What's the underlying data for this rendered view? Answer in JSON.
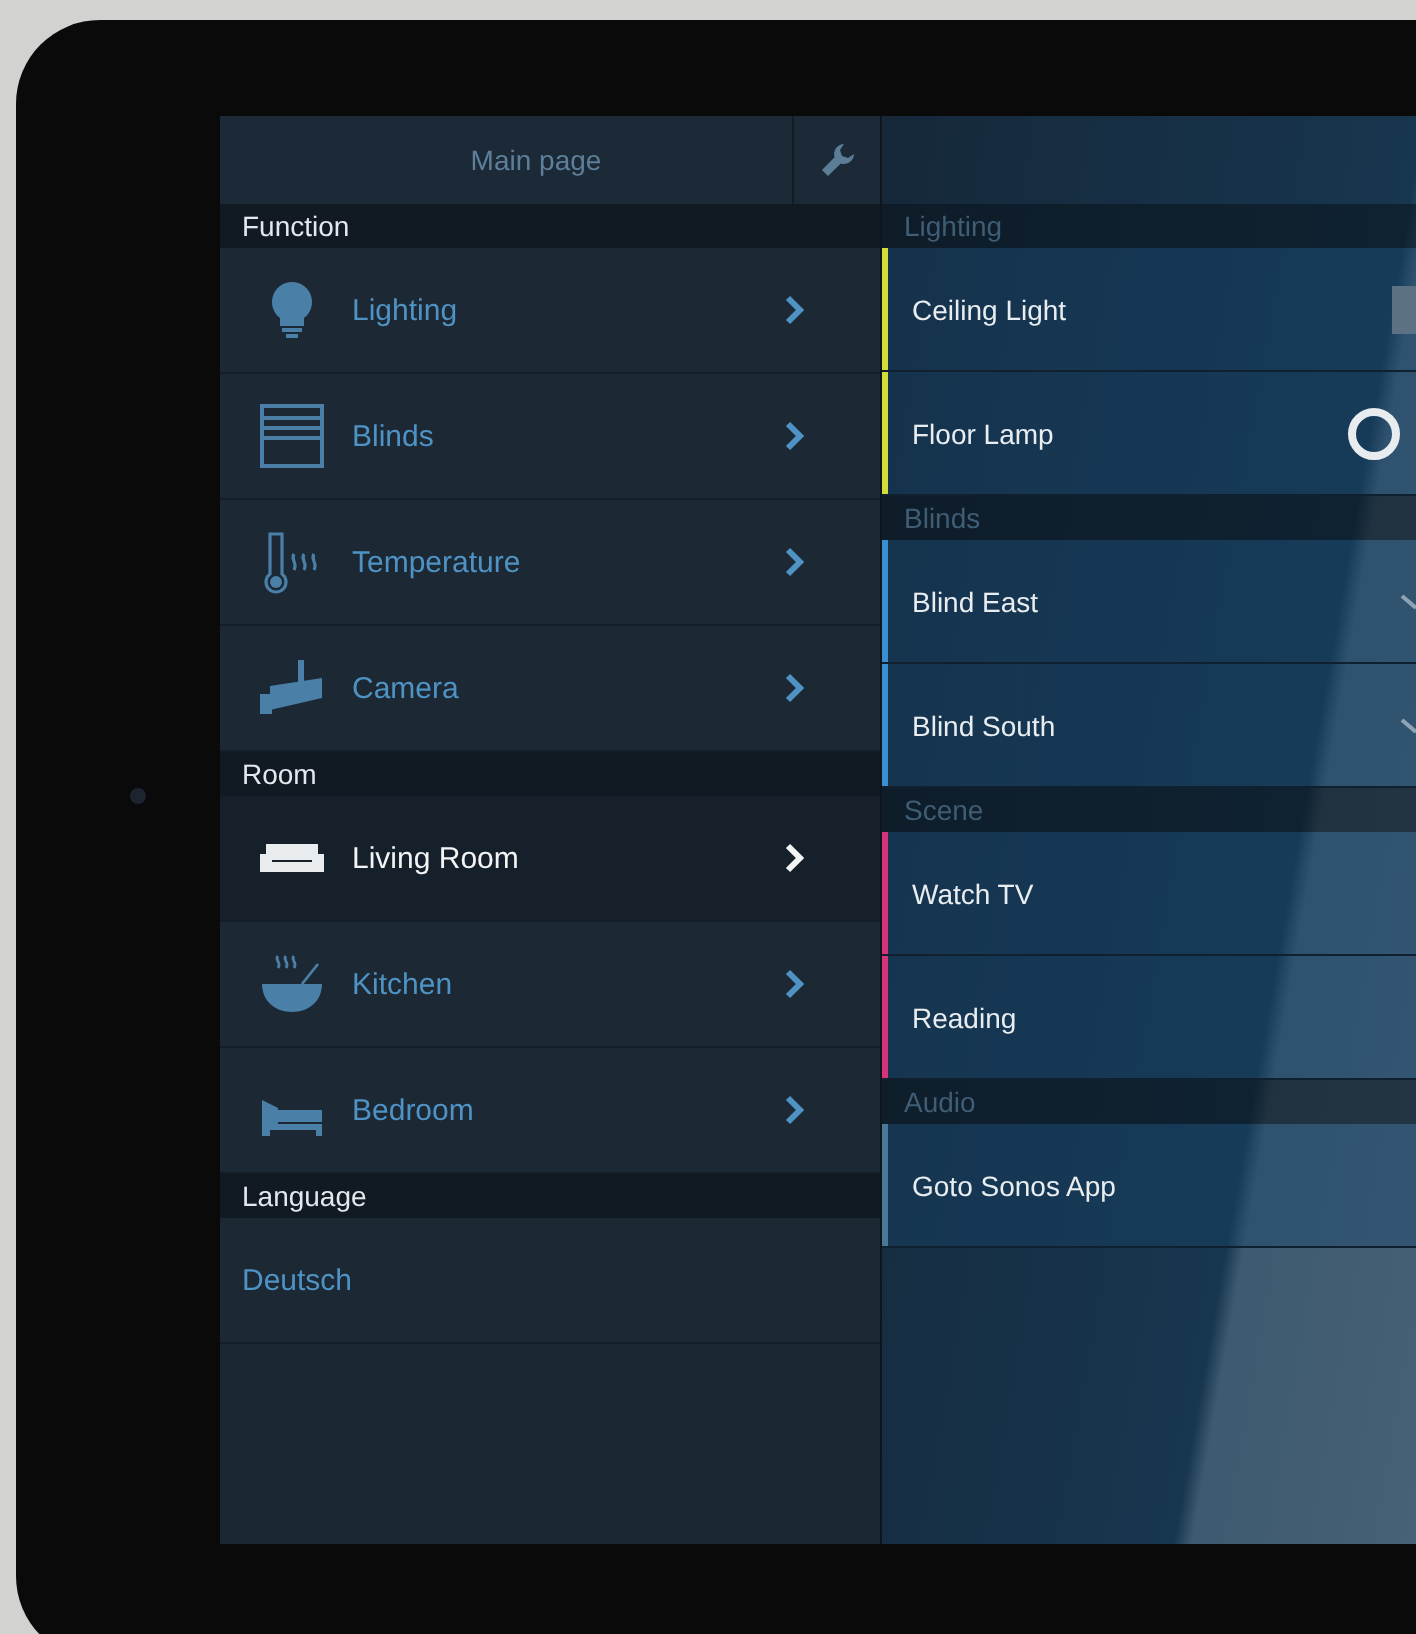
{
  "header": {
    "title": "Main page"
  },
  "menu": [
    {
      "heading": "Function",
      "items": [
        {
          "label": "Lighting",
          "selected": false
        },
        {
          "label": "Blinds",
          "selected": false
        },
        {
          "label": "Temperature",
          "selected": false
        },
        {
          "label": "Camera",
          "selected": false
        }
      ]
    },
    {
      "heading": "Room",
      "items": [
        {
          "label": "Living Room",
          "selected": true
        },
        {
          "label": "Kitchen",
          "selected": false
        },
        {
          "label": "Bedroom",
          "selected": false
        }
      ]
    },
    {
      "heading": "Language",
      "items": [
        {
          "label": "Deutsch",
          "selected": false,
          "kind": "link"
        }
      ]
    }
  ],
  "detail": [
    {
      "heading": "Lighting",
      "items": [
        {
          "label": "Ceiling Light",
          "color": "#d4dc3a",
          "kind": "dimmer"
        },
        {
          "label": "Floor Lamp",
          "color": "#d4dc3a",
          "kind": "switch"
        }
      ]
    },
    {
      "heading": "Blinds",
      "items": [
        {
          "label": "Blind East",
          "color": "#3a8fd0",
          "kind": "blind"
        },
        {
          "label": "Blind South",
          "color": "#3a8fd0",
          "kind": "blind"
        }
      ]
    },
    {
      "heading": "Scene",
      "items": [
        {
          "label": "Watch TV",
          "color": "#d8327a",
          "kind": "scene"
        },
        {
          "label": "Reading",
          "color": "#d8327a",
          "kind": "scene"
        }
      ]
    },
    {
      "heading": "Audio",
      "items": [
        {
          "label": "Goto Sonos App",
          "color": "#4a7899",
          "kind": "link"
        }
      ]
    }
  ]
}
